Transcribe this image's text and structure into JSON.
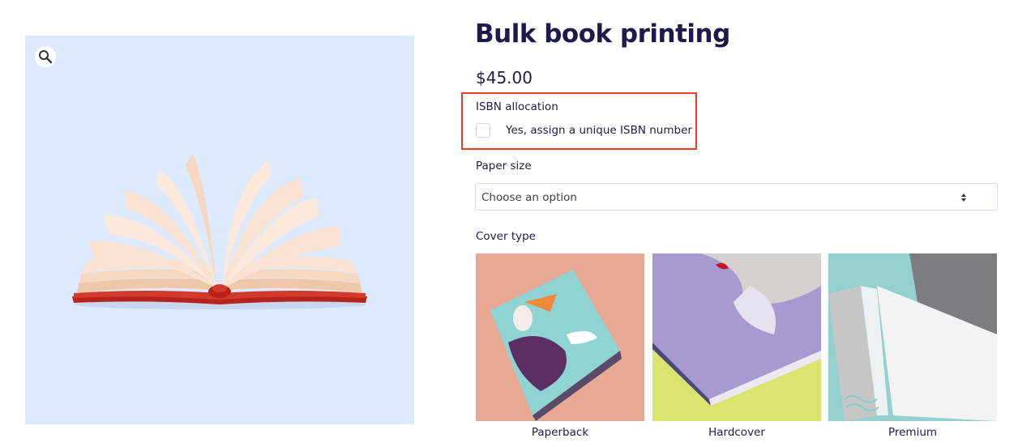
{
  "product": {
    "title": "Bulk book printing",
    "price": "$45.00"
  },
  "gallery": {
    "zoom_icon": "magnifier-icon",
    "background": "#dde9fc"
  },
  "isbn": {
    "label": "ISBN allocation",
    "checkbox_label": "Yes, assign a unique ISBN number",
    "checked": false,
    "highlight_color": "#ee3a27"
  },
  "paper_size": {
    "label": "Paper size",
    "selected": "Choose an option"
  },
  "cover_type": {
    "label": "Cover type",
    "options": [
      {
        "name": "Paperback"
      },
      {
        "name": "Hardcover"
      },
      {
        "name": "Premium"
      }
    ]
  },
  "colors": {
    "text": "#1e1b4b",
    "accent": "#ee3a27"
  }
}
